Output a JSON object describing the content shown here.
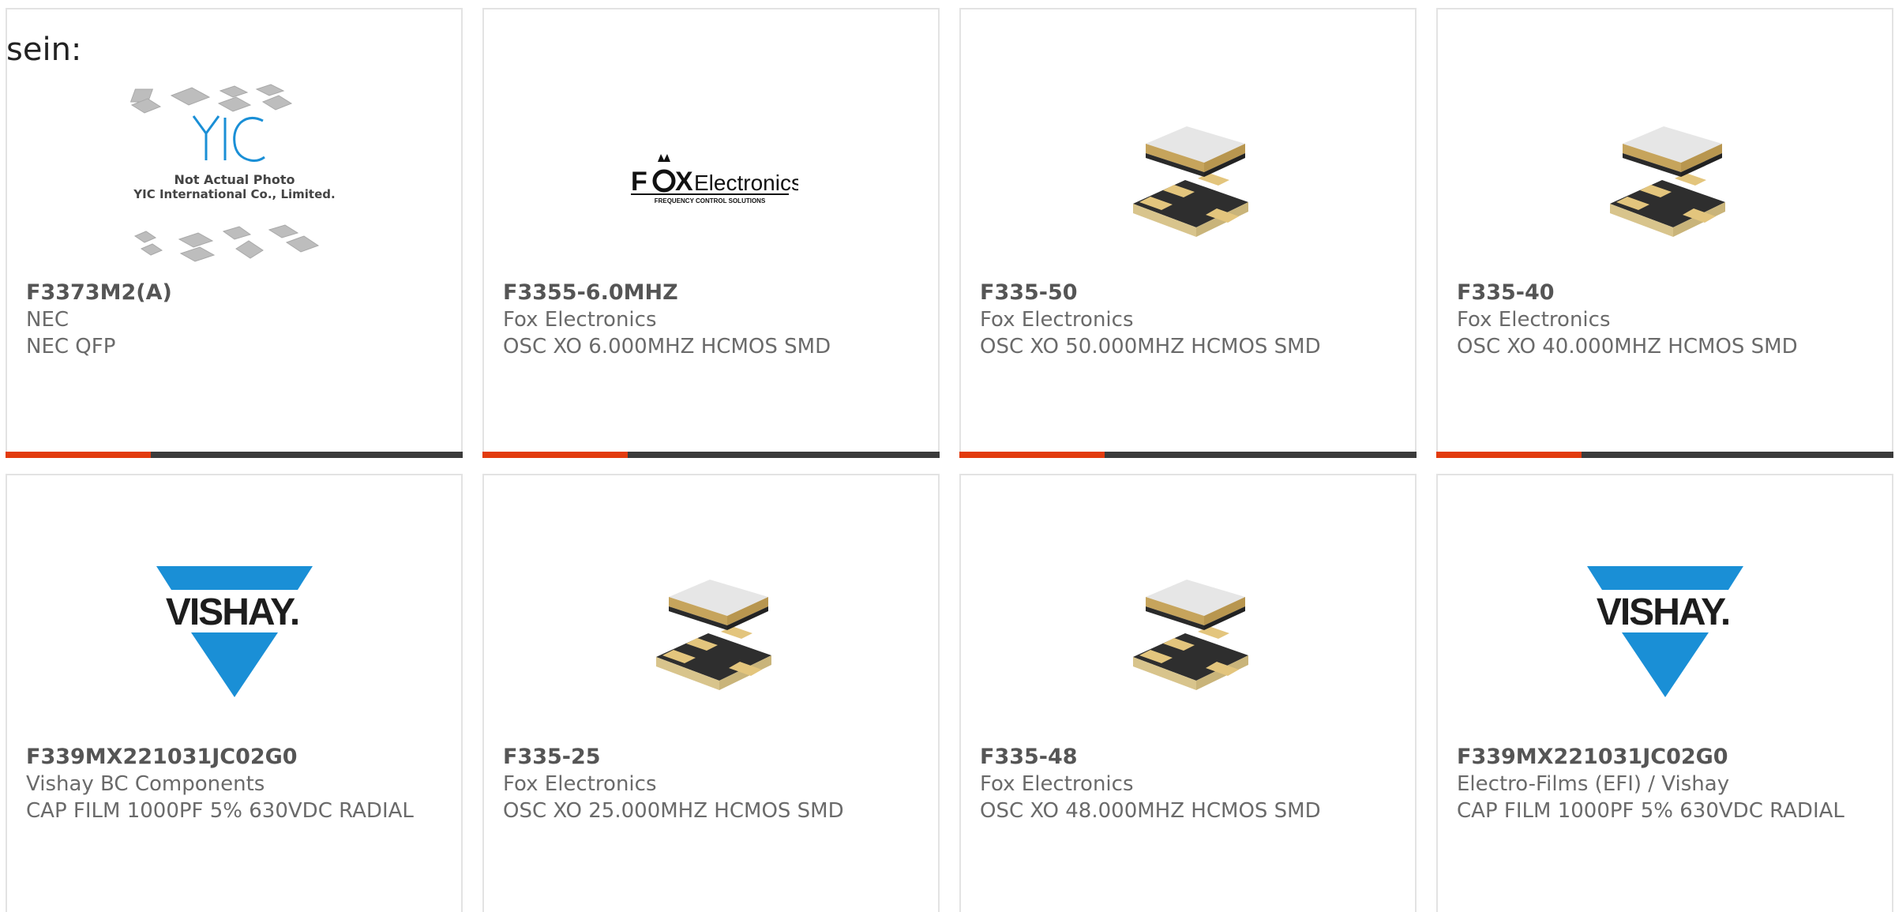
{
  "intro_text": "sein:",
  "colors": {
    "accent": "#e23b0e",
    "bar": "#3b3b3b",
    "vishay_blue": "#1a8fd6"
  },
  "products": [
    {
      "part": "F3373M2(A)",
      "mfr": "NEC",
      "desc": "NEC QFP",
      "image": "yic-placeholder",
      "image_text": {
        "logo": "YIC",
        "line1": "Not Actual Photo",
        "line2": "YIC International Co., Limited."
      }
    },
    {
      "part": "F3355-6.0MHZ",
      "mfr": "Fox Electronics",
      "desc": "OSC XO 6.000MHZ HCMOS SMD",
      "image": "fox-logo",
      "image_text": {
        "brand_a": "F",
        "brand_b": "X",
        "brand_c": "Electronics",
        "tagline": "FREQUENCY CONTROL SOLUTIONS"
      }
    },
    {
      "part": "F335-50",
      "mfr": "Fox Electronics",
      "desc": "OSC XO 50.000MHZ HCMOS SMD",
      "image": "smd-crystal"
    },
    {
      "part": "F335-40",
      "mfr": "Fox Electronics",
      "desc": "OSC XO 40.000MHZ HCMOS SMD",
      "image": "smd-crystal"
    },
    {
      "part": "F339MX221031JC02G0",
      "mfr": "Vishay BC Components",
      "desc": "CAP FILM 1000PF 5% 630VDC RADIAL",
      "image": "vishay-logo",
      "image_text": {
        "logo": "VISHAY."
      }
    },
    {
      "part": "F335-25",
      "mfr": "Fox Electronics",
      "desc": "OSC XO 25.000MHZ HCMOS SMD",
      "image": "smd-crystal"
    },
    {
      "part": "F335-48",
      "mfr": "Fox Electronics",
      "desc": "OSC XO 48.000MHZ HCMOS SMD",
      "image": "smd-crystal"
    },
    {
      "part": "F339MX221031JC02G0",
      "mfr": "Electro-Films (EFI) / Vishay",
      "desc": "CAP FILM 1000PF 5% 630VDC RADIAL",
      "image": "vishay-logo",
      "image_text": {
        "logo": "VISHAY."
      }
    }
  ]
}
